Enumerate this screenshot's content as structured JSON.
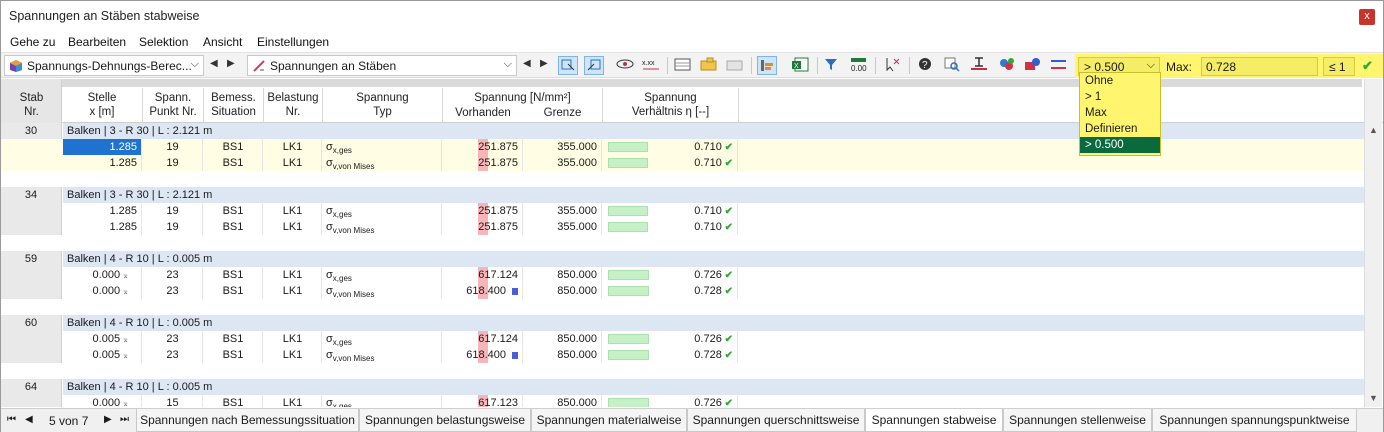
{
  "window": {
    "title": "Spannungen an Stäben stabweise",
    "close_label": "x"
  },
  "menu": [
    "Gehe zu",
    "Bearbeiten",
    "Selektion",
    "Ansicht",
    "Einstellungen"
  ],
  "toolbar": {
    "combo1": "Spannungs-Dehnungs-Berec...",
    "combo2": "Spannungen an Stäben",
    "filter_value": "> 0.500",
    "max_label": "Max:",
    "max_value": "0.728",
    "le_label": "≤ 1",
    "filter_options": [
      "Ohne",
      "> 1",
      "Max",
      "Definieren",
      "> 0.500"
    ],
    "filter_selected_index": 4
  },
  "columns": {
    "stab": [
      "Stab",
      "Nr."
    ],
    "stelle": [
      "Stelle",
      "x [m]"
    ],
    "spann": [
      "Spann.",
      "Punkt Nr."
    ],
    "bemess": [
      "Bemess.",
      "Situation"
    ],
    "belast": [
      "Belastung",
      "Nr."
    ],
    "typ": [
      "Spannung",
      "Typ"
    ],
    "spannung_group": "Spannung [N/mm²]",
    "vorhanden": "Vorhanden",
    "grenze": "Grenze",
    "ratio": [
      "Spannung",
      "Verhältnis η [--]"
    ]
  },
  "groups": [
    {
      "stab": "30",
      "desc": "Balken | 3 - R 30 | L : 2.121 m",
      "rows": [
        {
          "x": "1.285",
          "pt": "19",
          "bs": "BS1",
          "lk": "LK1",
          "typ": "σ",
          "typsub": "x,ges",
          "vor": "251.875",
          "gr": "355.000",
          "eta": "0.710",
          "ratio": 0.71,
          "sel": true
        },
        {
          "x": "1.285",
          "pt": "19",
          "bs": "BS1",
          "lk": "LK1",
          "typ": "σ",
          "typsub": "v,von Mises",
          "vor": "251.875",
          "gr": "355.000",
          "eta": "0.710",
          "ratio": 0.71
        }
      ]
    },
    {
      "stab": "34",
      "desc": "Balken | 3 - R 30 | L : 2.121 m",
      "rows": [
        {
          "x": "1.285",
          "pt": "19",
          "bs": "BS1",
          "lk": "LK1",
          "typ": "σ",
          "typsub": "x,ges",
          "vor": "251.875",
          "gr": "355.000",
          "eta": "0.710",
          "ratio": 0.71
        },
        {
          "x": "1.285",
          "pt": "19",
          "bs": "BS1",
          "lk": "LK1",
          "typ": "σ",
          "typsub": "v,von Mises",
          "vor": "251.875",
          "gr": "355.000",
          "eta": "0.710",
          "ratio": 0.71
        }
      ]
    },
    {
      "stab": "59",
      "desc": "Balken | 4 - R 10 | L : 0.005 m",
      "rows": [
        {
          "x": "0.000",
          "pt": "23",
          "bs": "BS1",
          "lk": "LK1",
          "typ": "σ",
          "typsub": "x,ges",
          "vor": "617.124",
          "gr": "850.000",
          "eta": "0.726",
          "ratio": 0.726
        },
        {
          "x": "0.000",
          "pt": "23",
          "bs": "BS1",
          "lk": "LK1",
          "typ": "σ",
          "typsub": "v,von Mises",
          "vor": "618.400",
          "gr": "850.000",
          "eta": "0.728",
          "ratio": 0.728
        }
      ]
    },
    {
      "stab": "60",
      "desc": "Balken | 4 - R 10 | L : 0.005 m",
      "rows": [
        {
          "x": "0.005",
          "pt": "23",
          "bs": "BS1",
          "lk": "LK1",
          "typ": "σ",
          "typsub": "x,ges",
          "vor": "617.124",
          "gr": "850.000",
          "eta": "0.726",
          "ratio": 0.726
        },
        {
          "x": "0.005",
          "pt": "23",
          "bs": "BS1",
          "lk": "LK1",
          "typ": "σ",
          "typsub": "v,von Mises",
          "vor": "618.400",
          "gr": "850.000",
          "eta": "0.728",
          "ratio": 0.728
        }
      ]
    },
    {
      "stab": "64",
      "desc": "Balken | 4 - R 10 | L : 0.005 m",
      "rows": [
        {
          "x": "0.000",
          "pt": "15",
          "bs": "BS1",
          "lk": "LK1",
          "typ": "σ",
          "typsub": "x,ges",
          "vor": "617.123",
          "gr": "850.000",
          "eta": "0.726",
          "ratio": 0.726
        }
      ]
    }
  ],
  "pager": {
    "label": "5 von 7"
  },
  "tabs": [
    "Spannungen nach Bemessungssituation",
    "Spannungen belastungsweise",
    "Spannungen materialweise",
    "Spannungen querschnittsweise",
    "Spannungen stabweise",
    "Spannungen stellenweise",
    "Spannungen spannungspunktweise"
  ],
  "active_tab": 4
}
